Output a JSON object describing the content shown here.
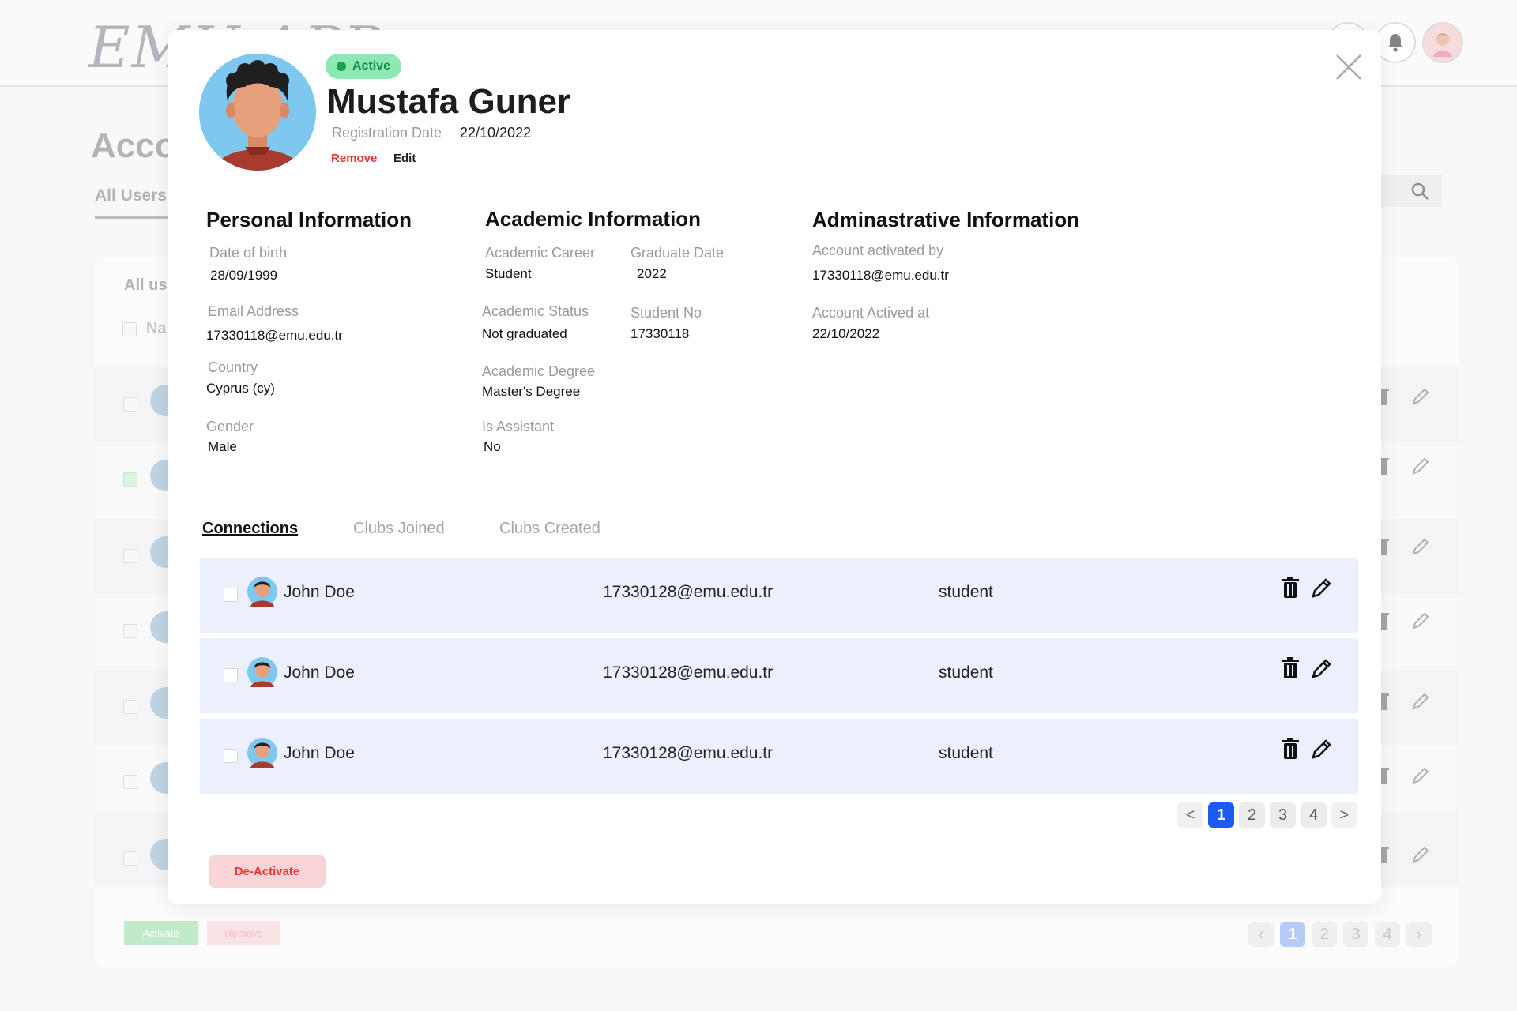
{
  "background": {
    "logo": "EMU APP",
    "title": "Accounts",
    "tab": "All Users",
    "card_title": "All users",
    "name_header": "Name",
    "activate_label": "Activate",
    "remove_label": "Remove",
    "pagination": {
      "pages": [
        "1",
        "2",
        "3",
        "4"
      ],
      "active": "1"
    }
  },
  "profile": {
    "status": "Active",
    "name": "Mustafa Guner",
    "registration_label": "Registration Date",
    "registration_date": "22/10/2022",
    "remove_label": "Remove",
    "edit_label": "Edit"
  },
  "personal": {
    "title": "Personal Information",
    "dob_label": "Date of birth",
    "dob": "28/09/1999",
    "email_label": "Email Address",
    "email": "17330118@emu.edu.tr",
    "country_label": "Country",
    "country": "Cyprus (cy)",
    "gender_label": "Gender",
    "gender": "Male"
  },
  "academic": {
    "title": "Academic Information",
    "career_label": "Academic Career",
    "career": "Student",
    "graduate_label": "Graduate Date",
    "graduate": "2022",
    "status_label": "Academic Status",
    "status": "Not graduated",
    "student_no_label": "Student No",
    "student_no": "17330118",
    "degree_label": "Academic Degree",
    "degree": "Master's Degree",
    "assistant_label": "Is Assistant",
    "assistant": "No"
  },
  "admin": {
    "title": "Adminastrative Information",
    "activated_by_label": "Account activated by",
    "activated_by": "17330118@emu.edu.tr",
    "activated_at_label": "Account Actived at",
    "activated_at": "22/10/2022"
  },
  "tabs": [
    "Connections",
    "Clubs Joined",
    "Clubs Created"
  ],
  "connections": [
    {
      "name": "John Doe",
      "email": "17330128@emu.edu.tr",
      "role": "student"
    },
    {
      "name": "John Doe",
      "email": "17330128@emu.edu.tr",
      "role": "student"
    },
    {
      "name": "John Doe",
      "email": "17330128@emu.edu.tr",
      "role": "student"
    }
  ],
  "pagination": {
    "prev": "<",
    "pages": [
      "1",
      "2",
      "3",
      "4"
    ],
    "next": ">",
    "active": "1"
  },
  "deactivate_label": "De-Activate",
  "colors": {
    "active_badge": "#8de8b2",
    "danger": "#e53935",
    "pager_active": "#1a5cf0",
    "row_bg": "#ecf0fc"
  }
}
